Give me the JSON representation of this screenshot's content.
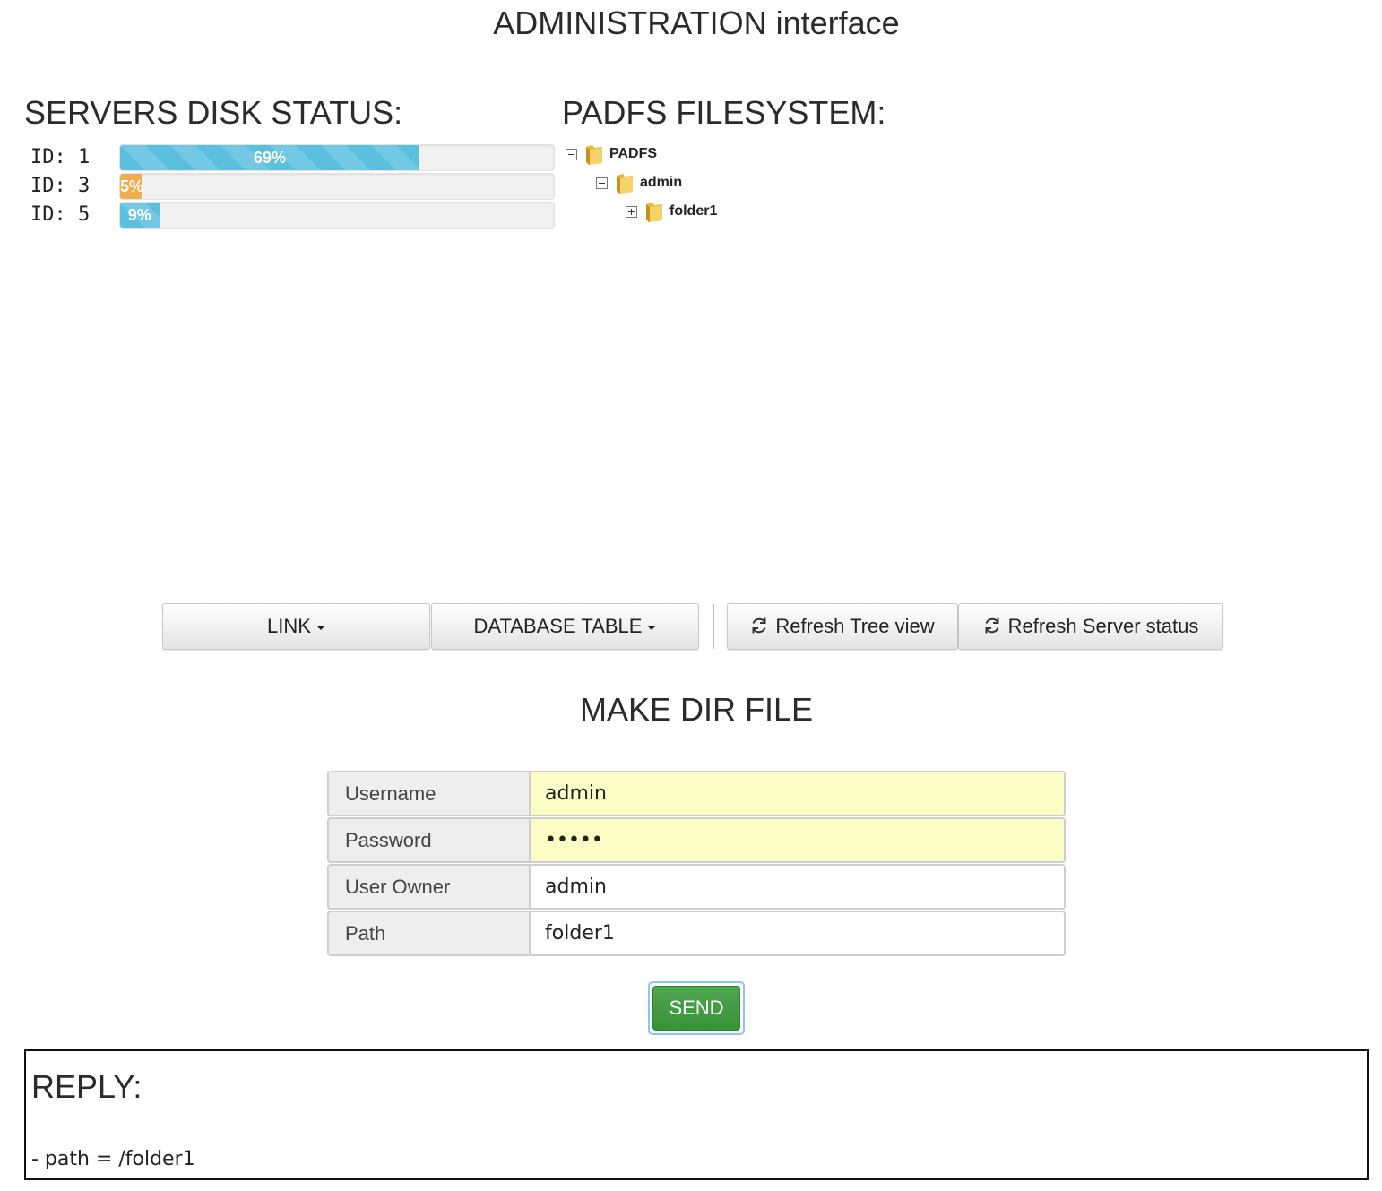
{
  "header": {
    "title": "ADMINISTRATION interface"
  },
  "disk_status": {
    "title": "SERVERS DISK STATUS:",
    "servers": [
      {
        "label": "ID: 1",
        "percent": 69,
        "text": "69%",
        "style": "info"
      },
      {
        "label": "ID: 3",
        "percent": 5,
        "text": "5%",
        "style": "warning"
      },
      {
        "label": "ID: 5",
        "percent": 9,
        "text": "9%",
        "style": "info"
      }
    ],
    "colors": {
      "info": "#5bc0de",
      "warning": "#f0ad4e"
    }
  },
  "filesystem": {
    "title": "PADFS FILESYSTEM:",
    "tree": [
      {
        "label": "PADFS",
        "state": "expanded",
        "icon": "folder-icon"
      },
      {
        "label": "admin",
        "state": "expanded",
        "icon": "folder-icon"
      },
      {
        "label": "folder1",
        "state": "collapsed",
        "icon": "folder-icon"
      }
    ]
  },
  "toolbar": {
    "link_label": "LINK",
    "database_label": "DATABASE TABLE",
    "refresh_tree_label": "Refresh Tree view",
    "refresh_server_label": "Refresh Server status"
  },
  "form": {
    "title": "MAKE DIR FILE",
    "fields": [
      {
        "label": "Username",
        "value": "admin"
      },
      {
        "label": "Password",
        "value": "•••••"
      },
      {
        "label": "User Owner",
        "value": "admin"
      },
      {
        "label": "Path",
        "value": "folder1"
      }
    ],
    "send_label": "SEND",
    "send_color": "#449d44"
  },
  "reply": {
    "title": "REPLY:",
    "text": "- path = /folder1"
  }
}
